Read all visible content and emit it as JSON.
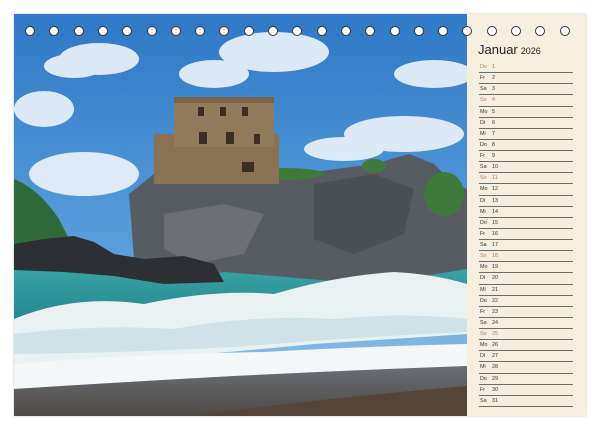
{
  "calendar": {
    "month": "Januar",
    "year": "2026",
    "days": [
      {
        "wd": "Do",
        "d": "1",
        "sunday": true
      },
      {
        "wd": "Fr",
        "d": "2",
        "sunday": false
      },
      {
        "wd": "Sa",
        "d": "3",
        "sunday": false
      },
      {
        "wd": "So",
        "d": "4",
        "sunday": true
      },
      {
        "wd": "Mo",
        "d": "5",
        "sunday": false
      },
      {
        "wd": "Di",
        "d": "6",
        "sunday": false
      },
      {
        "wd": "Mi",
        "d": "7",
        "sunday": false
      },
      {
        "wd": "Do",
        "d": "8",
        "sunday": false
      },
      {
        "wd": "Fr",
        "d": "9",
        "sunday": false
      },
      {
        "wd": "Sa",
        "d": "10",
        "sunday": false
      },
      {
        "wd": "So",
        "d": "11",
        "sunday": true
      },
      {
        "wd": "Mo",
        "d": "12",
        "sunday": false
      },
      {
        "wd": "Di",
        "d": "13",
        "sunday": false
      },
      {
        "wd": "Mi",
        "d": "14",
        "sunday": false
      },
      {
        "wd": "Do",
        "d": "15",
        "sunday": false
      },
      {
        "wd": "Fr",
        "d": "16",
        "sunday": false
      },
      {
        "wd": "Sa",
        "d": "17",
        "sunday": false
      },
      {
        "wd": "So",
        "d": "18",
        "sunday": true
      },
      {
        "wd": "Mo",
        "d": "19",
        "sunday": false
      },
      {
        "wd": "Di",
        "d": "20",
        "sunday": false
      },
      {
        "wd": "Mi",
        "d": "21",
        "sunday": false
      },
      {
        "wd": "Do",
        "d": "22",
        "sunday": false
      },
      {
        "wd": "Fr",
        "d": "23",
        "sunday": false
      },
      {
        "wd": "Sa",
        "d": "24",
        "sunday": false
      },
      {
        "wd": "So",
        "d": "25",
        "sunday": true
      },
      {
        "wd": "Mo",
        "d": "26",
        "sunday": false
      },
      {
        "wd": "Di",
        "d": "27",
        "sunday": false
      },
      {
        "wd": "Mi",
        "d": "28",
        "sunday": false
      },
      {
        "wd": "Do",
        "d": "29",
        "sunday": false
      },
      {
        "wd": "Fr",
        "d": "30",
        "sunday": false
      },
      {
        "wd": "Sa",
        "d": "31",
        "sunday": false
      }
    ]
  },
  "colors": {
    "sunday": "#c07a45",
    "panel": "#f6efdf",
    "sky": "#3f86cf"
  }
}
